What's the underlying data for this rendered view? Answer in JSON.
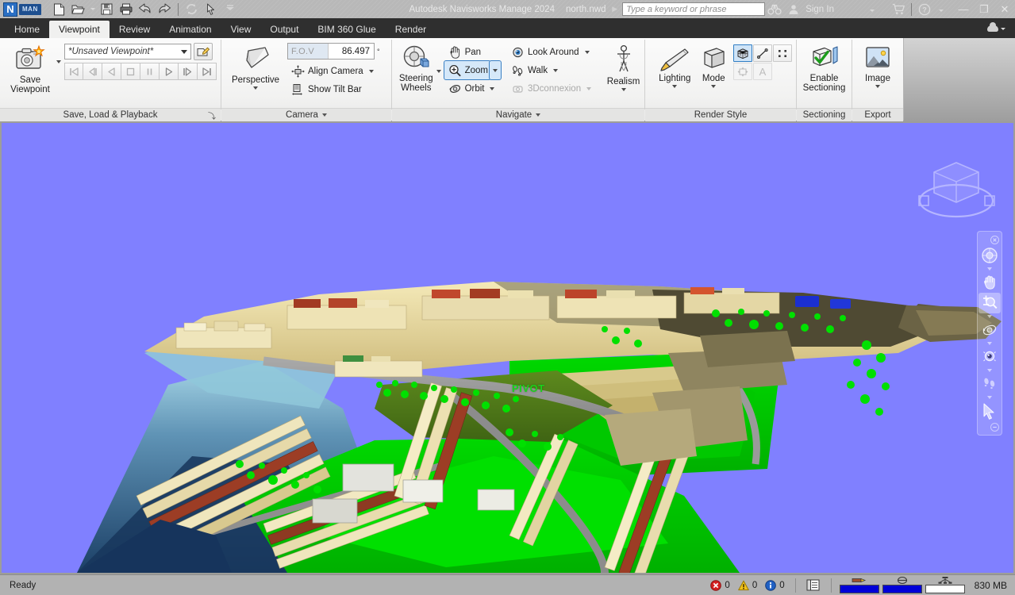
{
  "titlebar": {
    "logo_text": "N",
    "logo_badge": "MAN",
    "app_title": "Autodesk Navisworks Manage 2024",
    "file_name": "north.nwd",
    "quick_access": [
      {
        "name": "new-file-icon",
        "label": "New"
      },
      {
        "name": "open-file-icon",
        "label": "Open"
      },
      {
        "name": "open-dropdown-caret",
        "label": "Open options"
      },
      {
        "name": "save-icon",
        "label": "Save"
      },
      {
        "name": "print-icon",
        "label": "Print"
      },
      {
        "name": "undo-icon",
        "label": "Undo"
      },
      {
        "name": "redo-icon",
        "label": "Redo"
      },
      {
        "name": "refresh-icon",
        "label": "Refresh"
      },
      {
        "name": "select-cursor-icon",
        "label": "Select"
      },
      {
        "name": "customize-qat-caret",
        "label": "Customize Quick Access Toolbar"
      }
    ],
    "search_placeholder": "Type a keyword or phrase",
    "help_search_icon": "binoculars-icon",
    "sign_in_label": "Sign In",
    "account_icon": "person-icon",
    "cart_icon": "shopping-cart-icon",
    "help_icon": "question-mark-icon",
    "minimize_label": "—",
    "restore_label": "❐",
    "close_label": "✕"
  },
  "tabs": [
    {
      "label": "Home",
      "active": false
    },
    {
      "label": "Viewpoint",
      "active": true
    },
    {
      "label": "Review",
      "active": false
    },
    {
      "label": "Animation",
      "active": false
    },
    {
      "label": "View",
      "active": false
    },
    {
      "label": "Output",
      "active": false
    },
    {
      "label": "BIM 360 Glue",
      "active": false
    },
    {
      "label": "Render",
      "active": false
    }
  ],
  "ribbon": {
    "panels": [
      {
        "id": "save_load_playback",
        "title": "Save, Load & Playback",
        "has_launcher": true,
        "launcher_glyph": "⤵",
        "big_button": {
          "label_line1": "Save",
          "label_line2": "Viewpoint",
          "icon": "camera-star-icon",
          "has_dropdown": true
        },
        "viewpoint_combo_value": "*Unsaved Viewpoint*",
        "edit_viewpoint_icon": "edit-viewpoint-icon",
        "playback_buttons": [
          {
            "name": "rewind-to-start-button",
            "glyph": "⏮"
          },
          {
            "name": "step-back-button",
            "glyph": "⏴|"
          },
          {
            "name": "reverse-play-button",
            "glyph": "◁"
          },
          {
            "name": "stop-button",
            "glyph": "□"
          },
          {
            "name": "pause-button",
            "glyph": "‖"
          },
          {
            "name": "play-button",
            "glyph": "▷"
          },
          {
            "name": "step-forward-button",
            "glyph": "|▷"
          },
          {
            "name": "forward-to-end-button",
            "glyph": "⏭"
          }
        ]
      },
      {
        "id": "camera",
        "title": "Camera",
        "has_dropdown": true,
        "big_button": {
          "label_line1": "Perspective",
          "icon": "perspective-box-icon",
          "has_dropdown": true
        },
        "fov_label": "F.O.V",
        "fov_value": "86.497",
        "fov_unit": "°",
        "items": [
          {
            "label": "Align Camera",
            "icon": "align-camera-icon",
            "has_dropdown": true,
            "disabled": false
          },
          {
            "label": "Show Tilt Bar",
            "icon": "tilt-bar-icon",
            "has_dropdown": false,
            "disabled": false
          }
        ]
      },
      {
        "id": "navigate",
        "title": "Navigate",
        "has_dropdown": true,
        "big_button": {
          "label_line1": "Steering",
          "label_line2": "Wheels",
          "icon": "steering-wheel-icon",
          "has_dropdown": true
        },
        "items_col1": [
          {
            "label": "Pan",
            "icon": "hand-pan-icon",
            "has_dropdown": false,
            "selected": false,
            "disabled": false
          },
          {
            "label": "Zoom",
            "icon": "zoom-magnifier-icon",
            "has_dropdown": true,
            "selected": true,
            "disabled": false
          },
          {
            "label": "Orbit",
            "icon": "orbit-icon",
            "has_dropdown": true,
            "selected": false,
            "disabled": false
          }
        ],
        "items_col2": [
          {
            "label": "Look Around",
            "icon": "eye-look-icon",
            "has_dropdown": true,
            "selected": false,
            "disabled": false
          },
          {
            "label": "Walk",
            "icon": "footsteps-walk-icon",
            "has_dropdown": true,
            "selected": false,
            "disabled": false
          },
          {
            "label": "3Dconnexion",
            "icon": "3dconnexion-icon",
            "has_dropdown": true,
            "selected": false,
            "disabled": true
          }
        ],
        "realism_button": {
          "label_line1": "Realism",
          "icon": "avatar-person-icon",
          "has_dropdown": true
        }
      },
      {
        "id": "render_style",
        "title": "Render Style",
        "buttons": [
          {
            "label": "Lighting",
            "icon": "flashlight-icon",
            "has_dropdown": true
          },
          {
            "label": "Mode",
            "icon": "shaded-cube-icon",
            "has_dropdown": true
          }
        ],
        "mini_buttons": [
          {
            "name": "surfaces-toggle",
            "icon": "surfaces-icon",
            "selected": true,
            "disabled": false
          },
          {
            "name": "lines-toggle",
            "icon": "lines-icon",
            "selected": false,
            "disabled": false
          },
          {
            "name": "points-toggle",
            "icon": "points-icon",
            "selected": false,
            "disabled": false
          },
          {
            "name": "snap-points-toggle",
            "icon": "snap-points-icon",
            "selected": false,
            "disabled": true
          },
          {
            "name": "text-toggle",
            "icon": "text-a-icon",
            "selected": false,
            "disabled": true
          }
        ]
      },
      {
        "id": "sectioning",
        "title": "Sectioning",
        "big_button": {
          "label_line1": "Enable",
          "label_line2": "Sectioning",
          "icon": "sectioning-check-icon",
          "has_dropdown": false
        }
      },
      {
        "id": "export",
        "title": "Export",
        "big_button": {
          "label_line1": "Image",
          "icon": "image-export-icon",
          "has_dropdown": true
        }
      }
    ]
  },
  "viewport": {
    "background_color": "#8080ff",
    "pivot_label": "PIVOT",
    "pivot_color": "#1bd11b",
    "viewcube_name": "view-cube",
    "model_description": "3D city model of a coastal town with terrain, buildings, trees and water",
    "navbar": [
      {
        "name": "navbar-close-icon",
        "label": "Close",
        "type": "close"
      },
      {
        "name": "navbar-steering-wheel",
        "label": "Steering Wheels",
        "selected": false,
        "caret": true
      },
      {
        "name": "navbar-pan",
        "label": "Pan",
        "selected": false,
        "caret": false
      },
      {
        "name": "navbar-zoom",
        "label": "Zoom",
        "selected": true,
        "caret": true
      },
      {
        "name": "navbar-orbit",
        "label": "Orbit",
        "selected": false,
        "caret": true
      },
      {
        "name": "navbar-look-around",
        "label": "Look Around",
        "selected": false,
        "caret": true
      },
      {
        "name": "navbar-walk",
        "label": "Walk",
        "selected": false,
        "caret": true
      },
      {
        "name": "navbar-select",
        "label": "Select",
        "selected": false,
        "caret": false
      },
      {
        "name": "navbar-minimize-icon",
        "label": "Customize",
        "type": "minimize"
      }
    ]
  },
  "statusbar": {
    "status_text": "Ready",
    "error_count": "0",
    "warning_count": "0",
    "info_count": "0",
    "error_icon": "error-circle-icon",
    "warning_icon": "warning-triangle-icon",
    "info_icon": "info-circle-icon",
    "panel_icon": "panel-list-icon",
    "progress": [
      {
        "name": "pencil-progress",
        "icon": "pencil-icon",
        "filled": true
      },
      {
        "name": "disk-progress",
        "icon": "disk-icon",
        "filled": true
      },
      {
        "name": "web-progress",
        "icon": "web-icon",
        "filled": false
      }
    ],
    "memory_label": "830 MB"
  },
  "colors": {
    "accent_blue": "#2f7dc4",
    "selection_fill": "#cfe4f7",
    "viewport_bg": "#8080ff",
    "status_bg": "#b2b2b2",
    "ribbon_bg": "#f2f2f1",
    "progress_fill": "#0000d8"
  }
}
